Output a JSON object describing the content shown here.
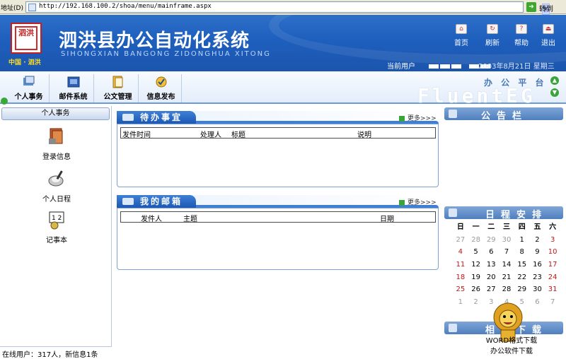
{
  "browser": {
    "address_label": "地址(D)",
    "url": "http://192.168.100.2/shoa/menu/mainframe.aspx",
    "go_label": "转到"
  },
  "header": {
    "logo_text": "泗洪",
    "logo_subtitle": "中国 · 泗洪",
    "title": "泗洪县办公自动化系统",
    "pinyin": "SIHONGXIAN BANGONG ZIDONGHUA XITONG",
    "buttons": [
      "首页",
      "刷新",
      "帮助",
      "退出"
    ],
    "current_user_label": "当前用户",
    "date_text": "2003年8月21日 星期三"
  },
  "toolbar": {
    "items": [
      "个人事务",
      "邮件系统",
      "公文管理",
      "信息发布"
    ],
    "platform_label": "办 公 平 台",
    "brand": "FluentEG"
  },
  "sidebar": {
    "title": "个人事务",
    "items": [
      "登录信息",
      "个人日程",
      "记事本"
    ],
    "online_text": "在线用户：317人，新信息1条"
  },
  "todo_panel": {
    "title": "待办事宜",
    "more": "更多>>>",
    "columns": [
      "发件时间",
      "处理人",
      "标题",
      "说明"
    ]
  },
  "mail_panel": {
    "title": "我的邮箱",
    "more": "更多>>>",
    "columns": [
      "发件人",
      "主题",
      "日期"
    ]
  },
  "right": {
    "notice_title": "公告栏",
    "calendar_title": "日程安排",
    "download_title": "相关下载",
    "download_text": [
      "WORD格式下载",
      "办公软件下载"
    ]
  },
  "calendar": {
    "weekdays": [
      "日",
      "一",
      "二",
      "三",
      "四",
      "五",
      "六"
    ],
    "weeks": [
      [
        "27",
        "28",
        "29",
        "30",
        "1",
        "2",
        "3"
      ],
      [
        "4",
        "5",
        "6",
        "7",
        "8",
        "9",
        "10"
      ],
      [
        "11",
        "12",
        "13",
        "14",
        "15",
        "16",
        "17"
      ],
      [
        "18",
        "19",
        "20",
        "21",
        "22",
        "23",
        "24"
      ],
      [
        "25",
        "26",
        "27",
        "28",
        "29",
        "30",
        "31"
      ],
      [
        "1",
        "2",
        "3",
        "4",
        "5",
        "6",
        "7"
      ]
    ]
  }
}
